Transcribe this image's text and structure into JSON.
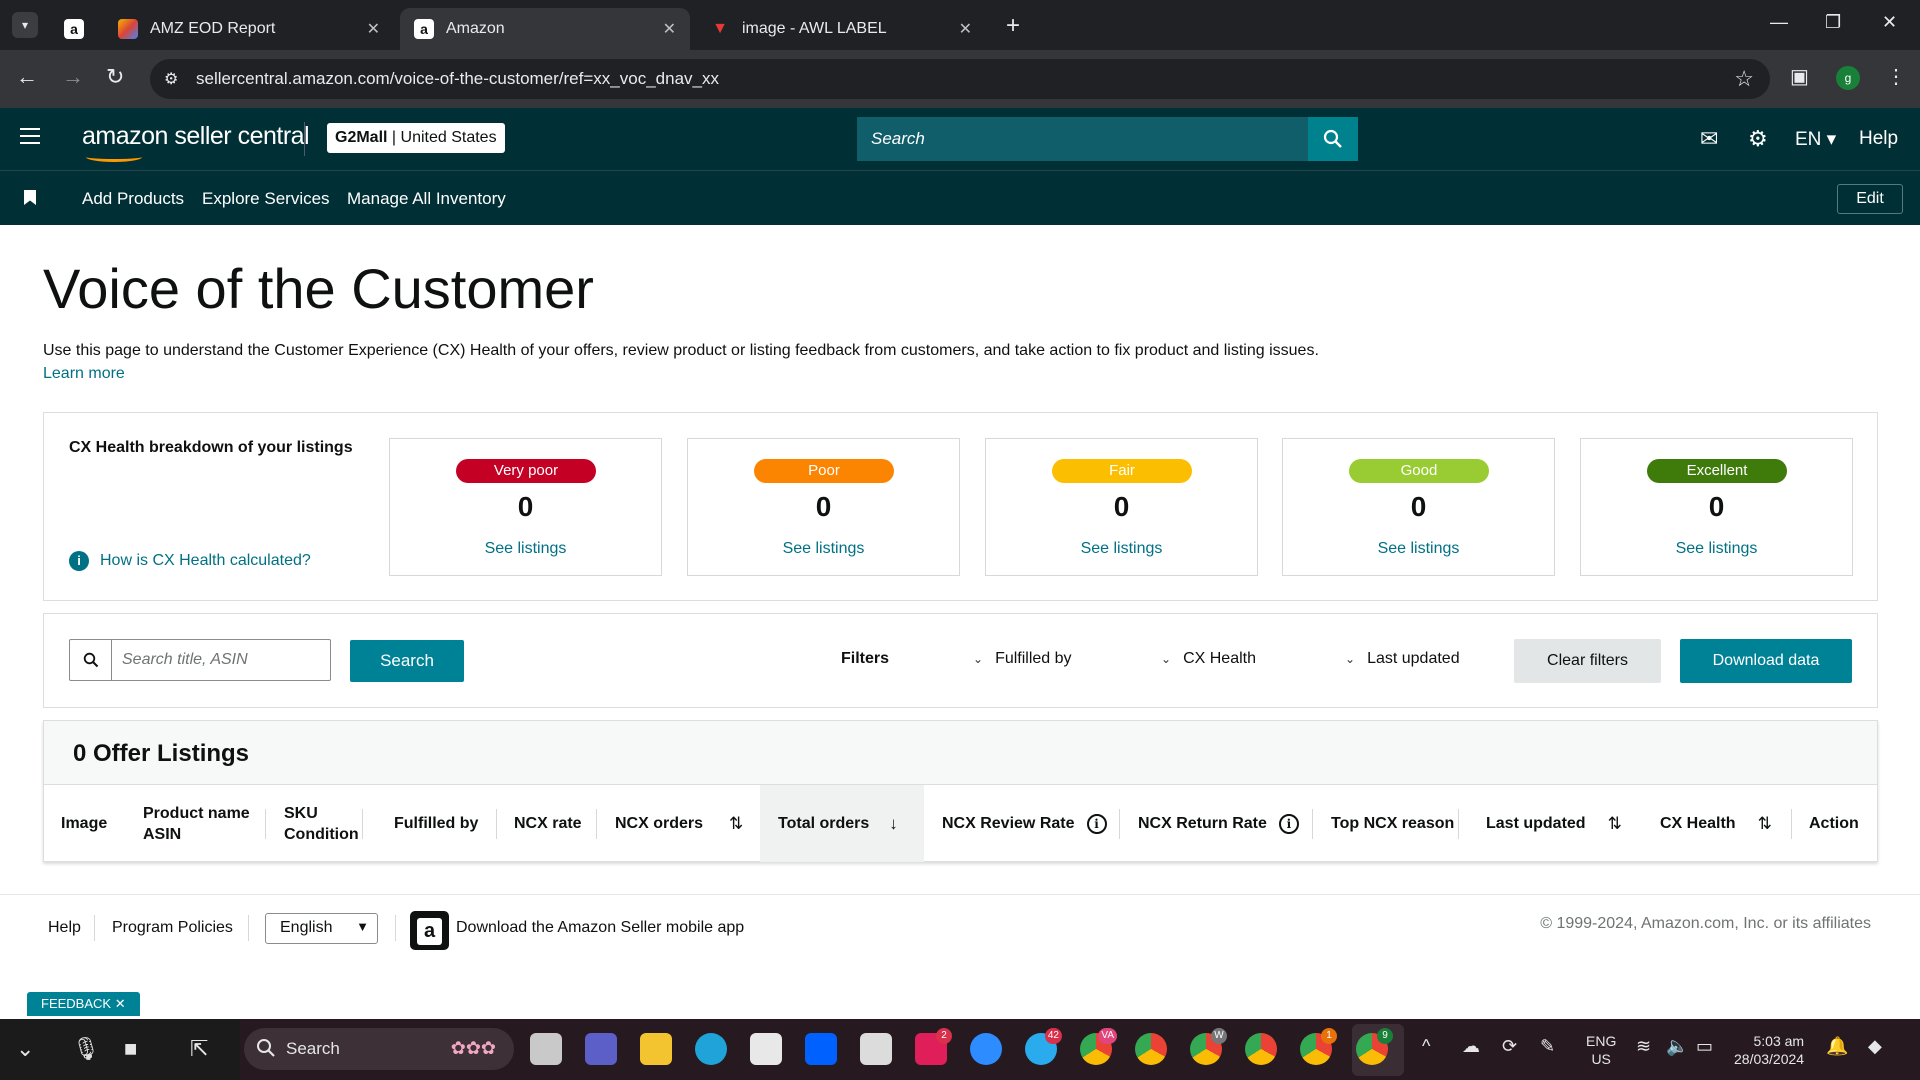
{
  "browser": {
    "tabs": [
      {
        "title": "",
        "favicon": "a"
      },
      {
        "title": "AMZ EOD Report",
        "favicon": "sheets"
      },
      {
        "title": "Amazon",
        "favicon": "a"
      },
      {
        "title": "image - AWL LABEL",
        "favicon": "awl"
      }
    ],
    "url": "sellercentral.amazon.com/voice-of-the-customer/ref=xx_voc_dnav_xx",
    "profile_initial": "g"
  },
  "header": {
    "logo_text": "amazon seller central",
    "store_name": "G2Mall",
    "store_region": "United States",
    "search_placeholder": "Search",
    "language": "EN",
    "help": "Help"
  },
  "quicklinks": {
    "items": [
      "Add Products",
      "Explore Services",
      "Manage All Inventory"
    ],
    "edit": "Edit"
  },
  "page": {
    "title": "Voice of the Customer",
    "intro": "Use this page to understand the Customer Experience (CX) Health of your offers, review product or listing feedback from customers, and take action to fix product and listing issues.",
    "learn_more": "Learn more"
  },
  "cx_health": {
    "title": "CX Health breakdown of your listings",
    "help_link": "How is CX Health calculated?",
    "cards": [
      {
        "label": "Very poor",
        "count": "0",
        "link": "See listings",
        "color": "#c40025"
      },
      {
        "label": "Poor",
        "count": "0",
        "link": "See listings",
        "color": "#fb8500"
      },
      {
        "label": "Fair",
        "count": "0",
        "link": "See listings",
        "color": "#fbbe00"
      },
      {
        "label": "Good",
        "count": "0",
        "link": "See listings",
        "color": "#99cc33"
      },
      {
        "label": "Excellent",
        "count": "0",
        "link": "See listings",
        "color": "#3e7b0b"
      }
    ]
  },
  "filters": {
    "search_placeholder": "Search title, ASIN",
    "search_button": "Search",
    "label": "Filters",
    "dropdowns": [
      "Fulfilled by",
      "CX Health",
      "Last updated"
    ],
    "clear": "Clear filters",
    "download": "Download data"
  },
  "listings": {
    "title": "0 Offer Listings",
    "columns": {
      "image": "Image",
      "product_name": "Product name",
      "asin": "ASIN",
      "sku": "SKU",
      "condition": "Condition",
      "fulfilled_by": "Fulfilled by",
      "ncx_rate": "NCX rate",
      "ncx_orders": "NCX orders",
      "total_orders": "Total orders",
      "ncx_review_rate": "NCX Review Rate",
      "ncx_return_rate": "NCX Return Rate",
      "top_ncx_reason": "Top NCX reason",
      "last_updated": "Last updated",
      "cx_health": "CX Health",
      "action": "Action"
    }
  },
  "footer": {
    "help": "Help",
    "policies": "Program Policies",
    "language": "English",
    "app_text": "Download the Amazon Seller mobile app",
    "copyright": "© 1999-2024, Amazon.com, Inc. or its affiliates",
    "feedback": "FEEDBACK"
  },
  "taskbar": {
    "search": "Search",
    "lang_line1": "ENG",
    "lang_line2": "US",
    "time": "5:03 am",
    "date": "28/03/2024",
    "badges": {
      "slack": "2",
      "telegram": "42",
      "chrome_va": "VA",
      "chrome_w": "W",
      "chrome_1": "1",
      "chrome_9": "9"
    }
  },
  "colors": {
    "header_bg": "#002f36",
    "teal_button": "#008296",
    "link": "#007185"
  }
}
